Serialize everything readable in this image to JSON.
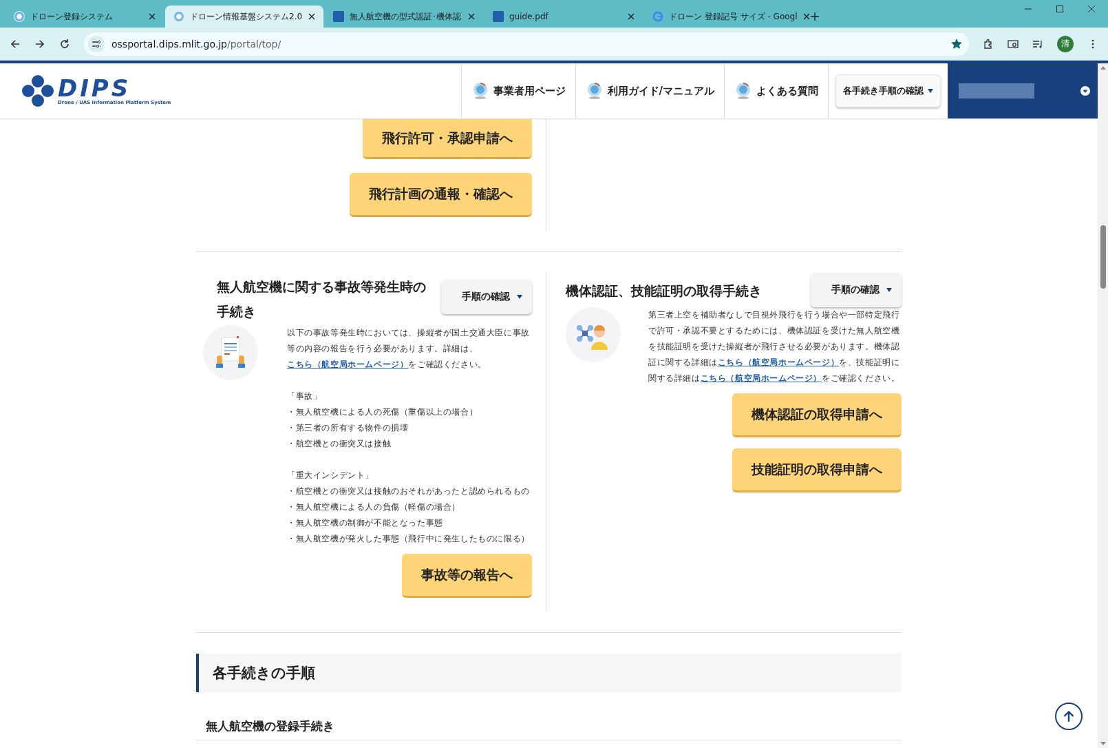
{
  "browser": {
    "tabs": [
      {
        "title": "ドローン登録システム",
        "kind": "dips",
        "selected": false
      },
      {
        "title": "ドローン情報基盤システム2.0",
        "kind": "dips",
        "selected": true
      },
      {
        "title": "無人航空機の型式認証･機体認",
        "kind": "doc",
        "selected": false
      },
      {
        "title": "guide.pdf",
        "kind": "doc",
        "selected": false
      },
      {
        "title": "ドローン 登録記号 サイズ - Googl",
        "kind": "google",
        "selected": false
      }
    ],
    "address": {
      "host": "ossportal.dips.mlit.go.jp",
      "path": "/portal/top/"
    },
    "bookmarked": true,
    "profile": "清"
  },
  "header": {
    "logo": {
      "title": "DIPS",
      "subtitle": "Drone / UAS Information Platform System"
    },
    "nav": [
      "事業者用ページ",
      "利用ガイド/マニュアル",
      "よくある質問"
    ],
    "procedures_button": "各手続き手順の確認"
  },
  "flight_buttons": [
    "飛行許可・承認申請へ",
    "飛行計画の通報・確認へ"
  ],
  "accident": {
    "title": "無人航空機に関する事故等発生時の手続き",
    "steps_button": "手順の確認",
    "intro": [
      {
        "text": "以下の事故等発生時においては、操縦者が国土交通大臣に事故等の内容の報告を行う必要があります。詳細は、",
        "kind": "text"
      },
      {
        "text": "こちら（航空局ホームページ）",
        "kind": "link"
      },
      {
        "text": "をご確認ください。",
        "kind": "text"
      }
    ],
    "groups": [
      {
        "heading": "「事故」",
        "items": [
          "・無人航空機による人の死傷（重傷以上の場合）",
          "・第三者の所有する物件の損壊",
          "・航空機との衝突又は接触"
        ]
      },
      {
        "heading": "「重大インシデント」",
        "items": [
          "・航空機との衝突又は接触のおそれがあったと認められるもの",
          "・無人航空機による人の負傷（軽傷の場合）",
          "・無人航空機の制御が不能となった事態",
          "・無人航空機が発火した事態（飛行中に発生したものに限る）"
        ]
      }
    ],
    "buttons": [
      "事故等の報告へ"
    ]
  },
  "certification": {
    "title": "機体認証、技能証明の取得手続き",
    "steps_button": "手順の確認",
    "intro": [
      {
        "text": "第三者上空を補助者なしで目視外飛行を行う場合や一部特定飛行で許可・承認不要とするためには、機体認証を受けた無人航空機を技能証明を受けた操縦者が飛行させる必要があります。機体認証に関する詳細は",
        "kind": "text"
      },
      {
        "text": "こちら（航空局ホームページ）",
        "kind": "link"
      },
      {
        "text": "を、技能証明に関する詳細は",
        "kind": "text"
      },
      {
        "text": "こちら（航空局ホームページ）",
        "kind": "link"
      },
      {
        "text": "をご確認ください。",
        "kind": "text"
      }
    ],
    "buttons": [
      "機体認証の取得申請へ",
      "技能証明の取得申請へ"
    ]
  },
  "procedures": {
    "heading": "各手続きの手順",
    "subheading": "無人航空機の登録手続き"
  }
}
